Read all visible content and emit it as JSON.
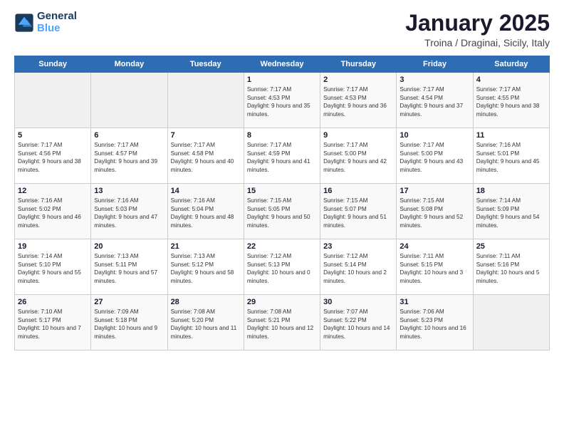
{
  "logo": {
    "line1": "General",
    "line2": "Blue"
  },
  "title": "January 2025",
  "subtitle": "Troina / Draginai, Sicily, Italy",
  "weekdays": [
    "Sunday",
    "Monday",
    "Tuesday",
    "Wednesday",
    "Thursday",
    "Friday",
    "Saturday"
  ],
  "weeks": [
    [
      {
        "day": "",
        "info": ""
      },
      {
        "day": "",
        "info": ""
      },
      {
        "day": "",
        "info": ""
      },
      {
        "day": "1",
        "info": "Sunrise: 7:17 AM\nSunset: 4:53 PM\nDaylight: 9 hours and 35 minutes."
      },
      {
        "day": "2",
        "info": "Sunrise: 7:17 AM\nSunset: 4:53 PM\nDaylight: 9 hours and 36 minutes."
      },
      {
        "day": "3",
        "info": "Sunrise: 7:17 AM\nSunset: 4:54 PM\nDaylight: 9 hours and 37 minutes."
      },
      {
        "day": "4",
        "info": "Sunrise: 7:17 AM\nSunset: 4:55 PM\nDaylight: 9 hours and 38 minutes."
      }
    ],
    [
      {
        "day": "5",
        "info": "Sunrise: 7:17 AM\nSunset: 4:56 PM\nDaylight: 9 hours and 38 minutes."
      },
      {
        "day": "6",
        "info": "Sunrise: 7:17 AM\nSunset: 4:57 PM\nDaylight: 9 hours and 39 minutes."
      },
      {
        "day": "7",
        "info": "Sunrise: 7:17 AM\nSunset: 4:58 PM\nDaylight: 9 hours and 40 minutes."
      },
      {
        "day": "8",
        "info": "Sunrise: 7:17 AM\nSunset: 4:59 PM\nDaylight: 9 hours and 41 minutes."
      },
      {
        "day": "9",
        "info": "Sunrise: 7:17 AM\nSunset: 5:00 PM\nDaylight: 9 hours and 42 minutes."
      },
      {
        "day": "10",
        "info": "Sunrise: 7:17 AM\nSunset: 5:00 PM\nDaylight: 9 hours and 43 minutes."
      },
      {
        "day": "11",
        "info": "Sunrise: 7:16 AM\nSunset: 5:01 PM\nDaylight: 9 hours and 45 minutes."
      }
    ],
    [
      {
        "day": "12",
        "info": "Sunrise: 7:16 AM\nSunset: 5:02 PM\nDaylight: 9 hours and 46 minutes."
      },
      {
        "day": "13",
        "info": "Sunrise: 7:16 AM\nSunset: 5:03 PM\nDaylight: 9 hours and 47 minutes."
      },
      {
        "day": "14",
        "info": "Sunrise: 7:16 AM\nSunset: 5:04 PM\nDaylight: 9 hours and 48 minutes."
      },
      {
        "day": "15",
        "info": "Sunrise: 7:15 AM\nSunset: 5:05 PM\nDaylight: 9 hours and 50 minutes."
      },
      {
        "day": "16",
        "info": "Sunrise: 7:15 AM\nSunset: 5:07 PM\nDaylight: 9 hours and 51 minutes."
      },
      {
        "day": "17",
        "info": "Sunrise: 7:15 AM\nSunset: 5:08 PM\nDaylight: 9 hours and 52 minutes."
      },
      {
        "day": "18",
        "info": "Sunrise: 7:14 AM\nSunset: 5:09 PM\nDaylight: 9 hours and 54 minutes."
      }
    ],
    [
      {
        "day": "19",
        "info": "Sunrise: 7:14 AM\nSunset: 5:10 PM\nDaylight: 9 hours and 55 minutes."
      },
      {
        "day": "20",
        "info": "Sunrise: 7:13 AM\nSunset: 5:11 PM\nDaylight: 9 hours and 57 minutes."
      },
      {
        "day": "21",
        "info": "Sunrise: 7:13 AM\nSunset: 5:12 PM\nDaylight: 9 hours and 58 minutes."
      },
      {
        "day": "22",
        "info": "Sunrise: 7:12 AM\nSunset: 5:13 PM\nDaylight: 10 hours and 0 minutes."
      },
      {
        "day": "23",
        "info": "Sunrise: 7:12 AM\nSunset: 5:14 PM\nDaylight: 10 hours and 2 minutes."
      },
      {
        "day": "24",
        "info": "Sunrise: 7:11 AM\nSunset: 5:15 PM\nDaylight: 10 hours and 3 minutes."
      },
      {
        "day": "25",
        "info": "Sunrise: 7:11 AM\nSunset: 5:16 PM\nDaylight: 10 hours and 5 minutes."
      }
    ],
    [
      {
        "day": "26",
        "info": "Sunrise: 7:10 AM\nSunset: 5:17 PM\nDaylight: 10 hours and 7 minutes."
      },
      {
        "day": "27",
        "info": "Sunrise: 7:09 AM\nSunset: 5:18 PM\nDaylight: 10 hours and 9 minutes."
      },
      {
        "day": "28",
        "info": "Sunrise: 7:08 AM\nSunset: 5:20 PM\nDaylight: 10 hours and 11 minutes."
      },
      {
        "day": "29",
        "info": "Sunrise: 7:08 AM\nSunset: 5:21 PM\nDaylight: 10 hours and 12 minutes."
      },
      {
        "day": "30",
        "info": "Sunrise: 7:07 AM\nSunset: 5:22 PM\nDaylight: 10 hours and 14 minutes."
      },
      {
        "day": "31",
        "info": "Sunrise: 7:06 AM\nSunset: 5:23 PM\nDaylight: 10 hours and 16 minutes."
      },
      {
        "day": "",
        "info": ""
      }
    ]
  ]
}
